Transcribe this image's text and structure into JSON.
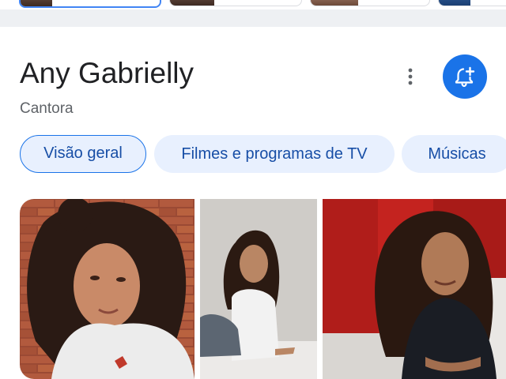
{
  "entity": {
    "name": "Any Gabrielly",
    "description": "Cantora"
  },
  "actions": {
    "more_icon": "more-vert-icon",
    "notify_icon": "bell-plus-icon",
    "accent_color": "#1a73e8"
  },
  "tabs": [
    {
      "label": "Visão geral",
      "selected": true
    },
    {
      "label": "Filmes e programas de TV",
      "selected": false
    },
    {
      "label": "Músicas",
      "selected": false
    }
  ],
  "images": [
    {
      "name": "photo-1"
    },
    {
      "name": "photo-2"
    },
    {
      "name": "photo-3"
    }
  ]
}
